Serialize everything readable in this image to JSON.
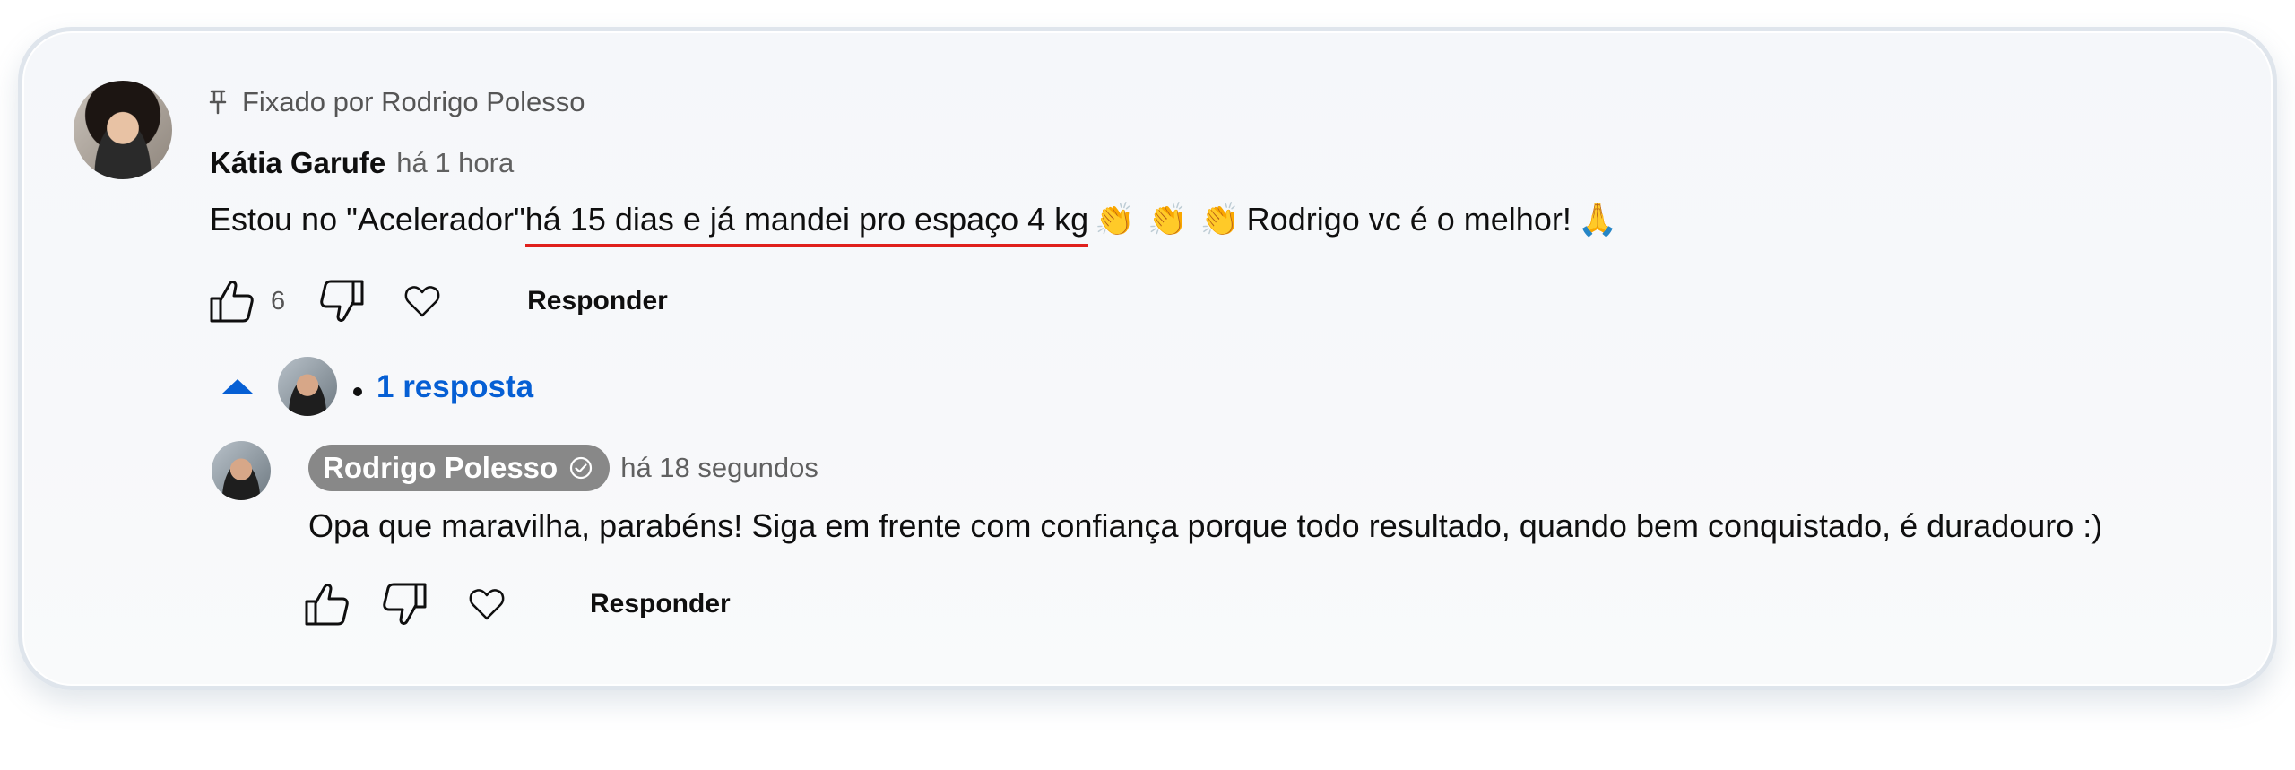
{
  "pinned": {
    "label": "Fixado por Rodrigo Polesso",
    "icon": "pin-icon"
  },
  "comment": {
    "author": "Kátia Garufe",
    "time": "há 1 hora",
    "text_before": "Estou no \"Acelerador\" ",
    "text_highlight": "há 15 dias e já mandei pro espaço 4 kg",
    "text_after": "Rodrigo vc é o melhor!",
    "emoji_clap": "👏",
    "emoji_pray": "🙏",
    "highlight_color": "#e0201c",
    "likes": "6",
    "reply_label": "Responder"
  },
  "replies": {
    "count_label": "1 resposta",
    "accent_color": "#065fd4",
    "expanded": true
  },
  "reply": {
    "author": "Rodrigo Polesso",
    "verified": true,
    "time": "há 18 segundos",
    "text": "Opa que maravilha, parabéns! Siga em frente com confiança porque todo resultado, quando bem conquistado, é duradouro :)",
    "reply_label": "Responder"
  }
}
